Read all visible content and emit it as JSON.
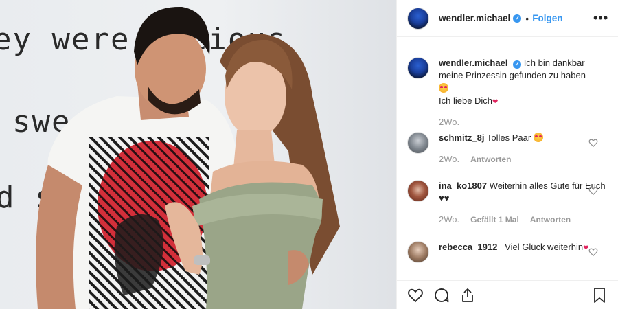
{
  "photo": {
    "wall_lines": [
      "ey were  licious",
      "swe",
      "d s"
    ]
  },
  "header": {
    "username": "wendler.michael",
    "verified_mark": "✓",
    "separator": "•",
    "follow_label": "Folgen",
    "more_icon": "more-options-icon",
    "more_glyph": "•••"
  },
  "caption": {
    "username": "wendler.michael",
    "text_line1": "Ich bin dankbar meine Prinzessin gefunden zu haben",
    "text_line2": "Ich liebe Dich",
    "time": "2Wo."
  },
  "comments": [
    {
      "username": "schmitz_8j",
      "text": "Tolles Paar",
      "time": "2Wo.",
      "likes": "",
      "reply_label": "Antworten"
    },
    {
      "username": "ina_ko1807",
      "text": "Weiterhin alles Gute für Euch ♥♥",
      "time": "2Wo.",
      "likes": "Gefällt 1 Mal",
      "reply_label": "Antworten"
    },
    {
      "username": "rebecca_1912_",
      "text": "Viel Glück weiterhin",
      "time": "",
      "likes": "",
      "reply_label": ""
    }
  ],
  "colors": {
    "accent": "#3897f0",
    "text": "#262626",
    "muted": "#999999",
    "border": "#efefef"
  },
  "actions": {
    "icons": [
      "heart-icon",
      "comment-icon",
      "share-icon",
      "bookmark-icon"
    ]
  }
}
